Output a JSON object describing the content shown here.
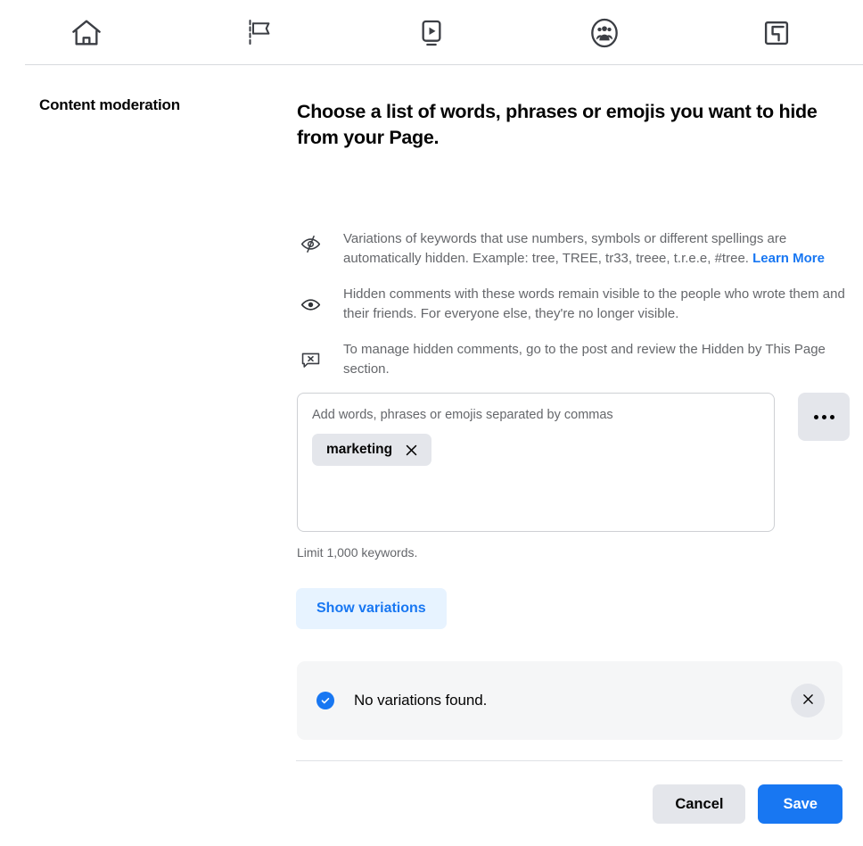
{
  "topnav": {
    "tabs": [
      {
        "icon": "home-icon",
        "name": "home"
      },
      {
        "icon": "flag-icon",
        "name": "pages"
      },
      {
        "icon": "video-icon",
        "name": "watch"
      },
      {
        "icon": "groups-icon",
        "name": "groups"
      },
      {
        "icon": "gaming-icon",
        "name": "gaming"
      }
    ]
  },
  "sidebar": {
    "title": "Content moderation"
  },
  "main": {
    "heading": "Choose a list of words, phrases or emojis you want to hide from your Page.",
    "info_rows": [
      {
        "icon": "eye-slash-icon",
        "text": "Variations of keywords that use numbers, symbols or different spellings are automatically hidden. Example: tree, TREE, tr33, treee, t.r.e.e, #tree. ",
        "link": "Learn More"
      },
      {
        "icon": "eye-icon",
        "text": "Hidden comments with these words remain visible to the people who wrote them and their friends. For everyone else, they're no longer visible.",
        "link": ""
      },
      {
        "icon": "comment-x-icon",
        "text": "To manage hidden comments, go to the post and review the Hidden by This Page section.",
        "link": ""
      }
    ],
    "keyword_input": {
      "placeholder": "Add words, phrases or emojis separated by commas",
      "chips": [
        {
          "label": "marketing",
          "remove_icon": "close-icon"
        }
      ],
      "more_button": "more-options-icon"
    },
    "limit_note": "Limit 1,000 keywords.",
    "show_variations_label": "Show variations",
    "notice": {
      "icon": "check-circle-icon",
      "text": "No variations found.",
      "close_icon": "close-icon"
    }
  },
  "footer": {
    "cancel_label": "Cancel",
    "save_label": "Save"
  },
  "colors": {
    "accent_blue": "#1877f2",
    "light_blue": "#e7f3ff",
    "chip_gray": "#e4e6eb",
    "notice_gray": "#f5f6f7",
    "text_secondary": "#65676b"
  }
}
